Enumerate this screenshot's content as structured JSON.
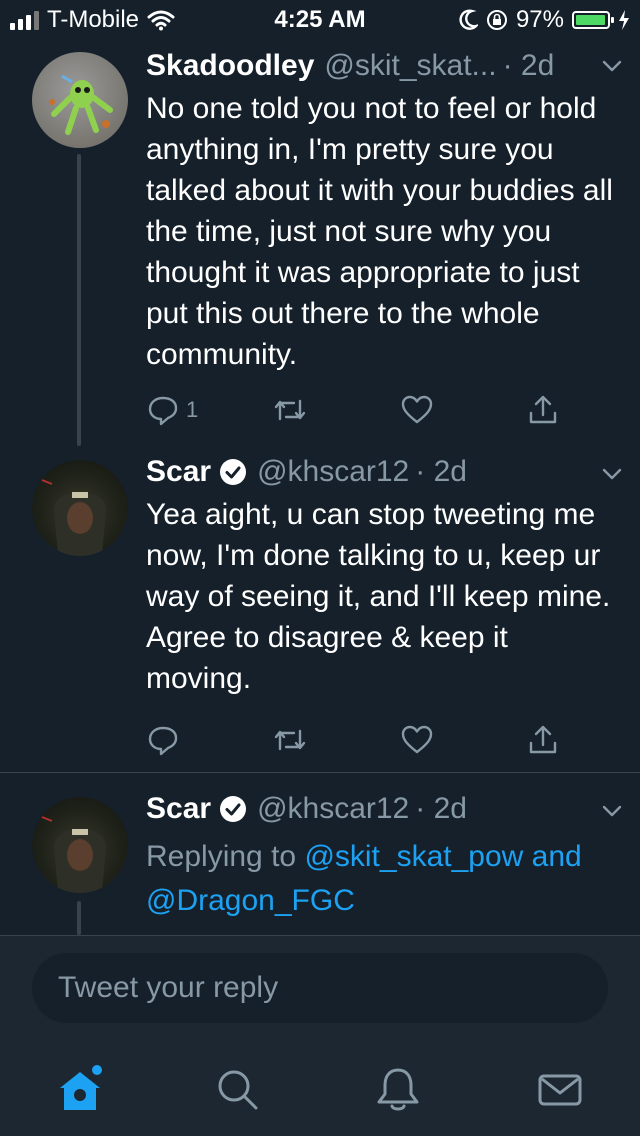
{
  "status_bar": {
    "carrier": "T-Mobile",
    "time": "4:25 AM",
    "battery": "97%"
  },
  "tweets": [
    {
      "name": "Skadoodley",
      "handle": "@skit_skat...",
      "time": "· 2d",
      "text": "No one told you not to feel or hold anything in, I'm pretty sure you talked about it with your buddies all the time, just not sure why you thought it was appropriate to just put this out there to the whole community.",
      "reply_count": "1"
    },
    {
      "name": "Scar",
      "handle": "@khscar12",
      "time": "· 2d",
      "text": "Yea aight, u can stop tweeting me now, I'm done talking to u, keep ur way of seeing it, and I'll keep mine. Agree to disagree & keep it moving."
    },
    {
      "name": "Scar",
      "handle": "@khscar12",
      "time": "· 2d",
      "replying_prefix": "Replying to",
      "mention_1": "@skit_skat_pow",
      "and": "and",
      "mention_2": "@Dragon_FGC"
    }
  ],
  "reply_bar": {
    "placeholder": "Tweet your reply"
  },
  "tabs": [
    {
      "icon": "home-icon",
      "active": true
    },
    {
      "icon": "search-icon",
      "active": false
    },
    {
      "icon": "bell-icon",
      "active": false
    },
    {
      "icon": "mail-icon",
      "active": false
    }
  ],
  "colors": {
    "background": "#15202b",
    "accent": "#1da1f2",
    "muted": "#8899a6",
    "divider": "#38444d",
    "battery": "#4cd964"
  }
}
